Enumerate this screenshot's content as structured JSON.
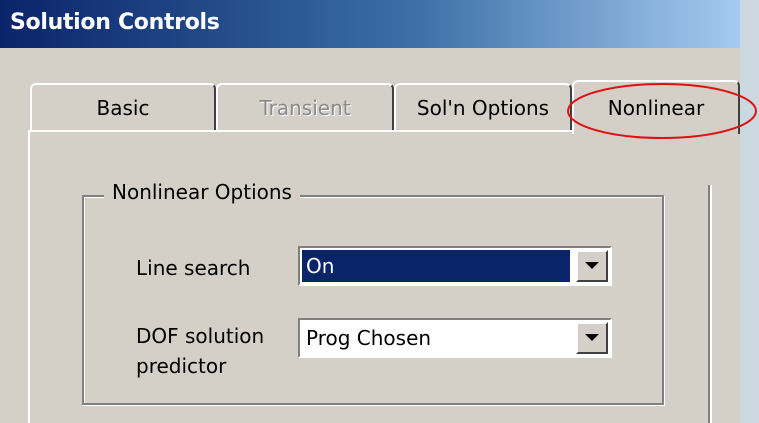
{
  "window": {
    "title": "Solution Controls"
  },
  "tabs": [
    {
      "label": "Basic",
      "state": "normal"
    },
    {
      "label": "Transient",
      "state": "disabled"
    },
    {
      "label": "Sol'n Options",
      "state": "normal"
    },
    {
      "label": "Nonlinear",
      "state": "active"
    }
  ],
  "nonlinear_options": {
    "group_title": "Nonlinear Options",
    "line_search": {
      "label": "Line search",
      "value": "On"
    },
    "dof_predictor": {
      "label_line1": "DOF solution",
      "label_line2": "predictor",
      "value": "Prog Chosen"
    }
  },
  "icons": {
    "dropdown": "chevron-down-icon"
  },
  "colors": {
    "titlebar_start": "#0a246a",
    "titlebar_end": "#a6caf0",
    "dialog_face": "#d4d0c8",
    "selection": "#0a246a",
    "annotation": "#e01010"
  }
}
